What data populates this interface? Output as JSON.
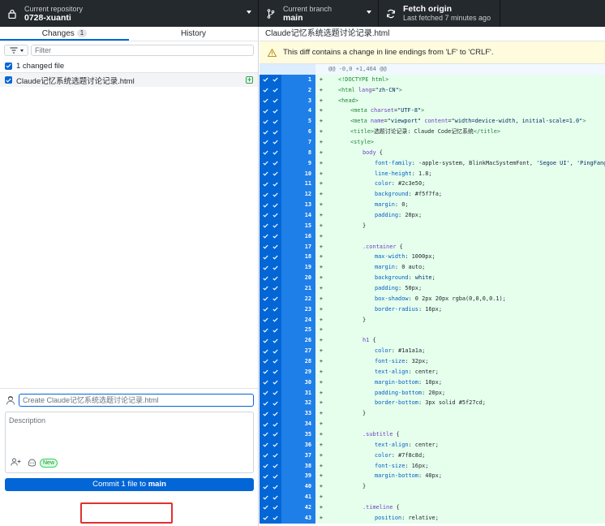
{
  "toolbar": {
    "repo": {
      "label": "Current repository",
      "value": "0728-xuanti"
    },
    "branch": {
      "label": "Current branch",
      "value": "main"
    },
    "fetch": {
      "label": "Fetch origin",
      "value": "Last fetched 7 minutes ago"
    }
  },
  "sidebar": {
    "tabs": [
      {
        "label": "Changes",
        "count": "1"
      },
      {
        "label": "History"
      }
    ],
    "filter_placeholder": "Filter",
    "changed_files_label": "1 changed file",
    "files": [
      {
        "name": "Claude记忆系统选题讨论记录.html",
        "status": "added"
      }
    ]
  },
  "commit": {
    "summary_placeholder": "Create Claude记忆系统选题讨论记录.html",
    "description_placeholder": "Description",
    "new_badge": "New",
    "button_prefix": "Commit 1 file to ",
    "button_branch": "main"
  },
  "diff": {
    "file_name": "Claude记忆系统选题讨论记录.html",
    "warning": "This diff contains a change in line endings from 'LF' to 'CRLF'.",
    "hunk": "@@ -0,0 +1,464 @@",
    "lines": [
      {
        "n": "1",
        "indent": 0,
        "parts": [
          [
            "tag",
            "<!DOCTYPE html>"
          ]
        ]
      },
      {
        "n": "2",
        "indent": 0,
        "parts": [
          [
            "tag",
            "<html "
          ],
          [
            "attr",
            "lang"
          ],
          [
            "val",
            "="
          ],
          [
            "str",
            "\"zh-CN\""
          ],
          [
            "tag",
            ">"
          ]
        ]
      },
      {
        "n": "3",
        "indent": 0,
        "parts": [
          [
            "tag",
            "<head>"
          ]
        ]
      },
      {
        "n": "4",
        "indent": 1,
        "parts": [
          [
            "tag",
            "<meta "
          ],
          [
            "attr",
            "charset"
          ],
          [
            "val",
            "="
          ],
          [
            "str",
            "\"UTF-8\""
          ],
          [
            "tag",
            ">"
          ]
        ]
      },
      {
        "n": "5",
        "indent": 1,
        "parts": [
          [
            "tag",
            "<meta "
          ],
          [
            "attr",
            "name"
          ],
          [
            "val",
            "="
          ],
          [
            "str",
            "\"viewport\""
          ],
          [
            "val",
            " "
          ],
          [
            "attr",
            "content"
          ],
          [
            "val",
            "="
          ],
          [
            "str",
            "\"width=device-width, initial-scale=1.0\""
          ],
          [
            "tag",
            ">"
          ]
        ]
      },
      {
        "n": "6",
        "indent": 1,
        "parts": [
          [
            "tag",
            "<title>"
          ],
          [
            "val",
            "选题讨论记录: Claude Code记忆系统"
          ],
          [
            "tag",
            "</title>"
          ]
        ]
      },
      {
        "n": "7",
        "indent": 1,
        "parts": [
          [
            "tag",
            "<style>"
          ]
        ]
      },
      {
        "n": "8",
        "indent": 2,
        "parts": [
          [
            "sel",
            "body"
          ],
          [
            "val",
            " {"
          ]
        ]
      },
      {
        "n": "9",
        "indent": 3,
        "parts": [
          [
            "prop",
            "font-family"
          ],
          [
            "val",
            ": -apple-system, BlinkMacSystemFont, "
          ],
          [
            "str",
            "'Segoe UI'"
          ],
          [
            "val",
            ", "
          ],
          [
            "str",
            "'PingFang SC'"
          ],
          [
            "val",
            ","
          ]
        ]
      },
      {
        "n": "10",
        "indent": 3,
        "parts": [
          [
            "prop",
            "line-height"
          ],
          [
            "val",
            ": 1.8;"
          ]
        ]
      },
      {
        "n": "11",
        "indent": 3,
        "parts": [
          [
            "prop",
            "color"
          ],
          [
            "val",
            ": #2c3e50;"
          ]
        ]
      },
      {
        "n": "12",
        "indent": 3,
        "parts": [
          [
            "prop",
            "background"
          ],
          [
            "val",
            ": #f5f7fa;"
          ]
        ]
      },
      {
        "n": "13",
        "indent": 3,
        "parts": [
          [
            "prop",
            "margin"
          ],
          [
            "val",
            ": 0;"
          ]
        ]
      },
      {
        "n": "14",
        "indent": 3,
        "parts": [
          [
            "prop",
            "padding"
          ],
          [
            "val",
            ": 20px;"
          ]
        ]
      },
      {
        "n": "15",
        "indent": 2,
        "parts": [
          [
            "val",
            "}"
          ]
        ]
      },
      {
        "n": "16",
        "indent": 0,
        "parts": []
      },
      {
        "n": "17",
        "indent": 2,
        "parts": [
          [
            "sel",
            ".container"
          ],
          [
            "val",
            " {"
          ]
        ]
      },
      {
        "n": "18",
        "indent": 3,
        "parts": [
          [
            "prop",
            "max-width"
          ],
          [
            "val",
            ": 1000px;"
          ]
        ]
      },
      {
        "n": "19",
        "indent": 3,
        "parts": [
          [
            "prop",
            "margin"
          ],
          [
            "val",
            ": 0 auto;"
          ]
        ]
      },
      {
        "n": "20",
        "indent": 3,
        "parts": [
          [
            "prop",
            "background"
          ],
          [
            "val",
            ": "
          ],
          [
            "str",
            "white"
          ],
          [
            "val",
            ";"
          ]
        ]
      },
      {
        "n": "21",
        "indent": 3,
        "parts": [
          [
            "prop",
            "padding"
          ],
          [
            "val",
            ": 50px;"
          ]
        ]
      },
      {
        "n": "22",
        "indent": 3,
        "parts": [
          [
            "prop",
            "box-shadow"
          ],
          [
            "val",
            ": 0 2px 20px rgba(0,0,0,0.1);"
          ]
        ]
      },
      {
        "n": "23",
        "indent": 3,
        "parts": [
          [
            "prop",
            "border-radius"
          ],
          [
            "val",
            ": 16px;"
          ]
        ]
      },
      {
        "n": "24",
        "indent": 2,
        "parts": [
          [
            "val",
            "}"
          ]
        ]
      },
      {
        "n": "25",
        "indent": 0,
        "parts": []
      },
      {
        "n": "26",
        "indent": 2,
        "parts": [
          [
            "sel",
            "h1"
          ],
          [
            "val",
            " {"
          ]
        ]
      },
      {
        "n": "27",
        "indent": 3,
        "parts": [
          [
            "prop",
            "color"
          ],
          [
            "val",
            ": #1a1a1a;"
          ]
        ]
      },
      {
        "n": "28",
        "indent": 3,
        "parts": [
          [
            "prop",
            "font-size"
          ],
          [
            "val",
            ": 32px;"
          ]
        ]
      },
      {
        "n": "29",
        "indent": 3,
        "parts": [
          [
            "prop",
            "text-align"
          ],
          [
            "val",
            ": center;"
          ]
        ]
      },
      {
        "n": "30",
        "indent": 3,
        "parts": [
          [
            "prop",
            "margin-bottom"
          ],
          [
            "val",
            ": 10px;"
          ]
        ]
      },
      {
        "n": "31",
        "indent": 3,
        "parts": [
          [
            "prop",
            "padding-bottom"
          ],
          [
            "val",
            ": 20px;"
          ]
        ]
      },
      {
        "n": "32",
        "indent": 3,
        "parts": [
          [
            "prop",
            "border-bottom"
          ],
          [
            "val",
            ": 3px solid #5f27cd;"
          ]
        ]
      },
      {
        "n": "33",
        "indent": 2,
        "parts": [
          [
            "val",
            "}"
          ]
        ]
      },
      {
        "n": "34",
        "indent": 0,
        "parts": []
      },
      {
        "n": "35",
        "indent": 2,
        "parts": [
          [
            "sel",
            ".subtitle"
          ],
          [
            "val",
            " {"
          ]
        ]
      },
      {
        "n": "36",
        "indent": 3,
        "parts": [
          [
            "prop",
            "text-align"
          ],
          [
            "val",
            ": center;"
          ]
        ]
      },
      {
        "n": "37",
        "indent": 3,
        "parts": [
          [
            "prop",
            "color"
          ],
          [
            "val",
            ": #7f8c8d;"
          ]
        ]
      },
      {
        "n": "38",
        "indent": 3,
        "parts": [
          [
            "prop",
            "font-size"
          ],
          [
            "val",
            ": 16px;"
          ]
        ]
      },
      {
        "n": "39",
        "indent": 3,
        "parts": [
          [
            "prop",
            "margin-bottom"
          ],
          [
            "val",
            ": 40px;"
          ]
        ]
      },
      {
        "n": "40",
        "indent": 2,
        "parts": [
          [
            "val",
            "}"
          ]
        ]
      },
      {
        "n": "41",
        "indent": 0,
        "parts": []
      },
      {
        "n": "42",
        "indent": 2,
        "parts": [
          [
            "sel",
            ".timeline"
          ],
          [
            "val",
            " {"
          ]
        ]
      },
      {
        "n": "43",
        "indent": 3,
        "parts": [
          [
            "prop",
            "position"
          ],
          [
            "val",
            ": relative;"
          ]
        ]
      }
    ]
  }
}
